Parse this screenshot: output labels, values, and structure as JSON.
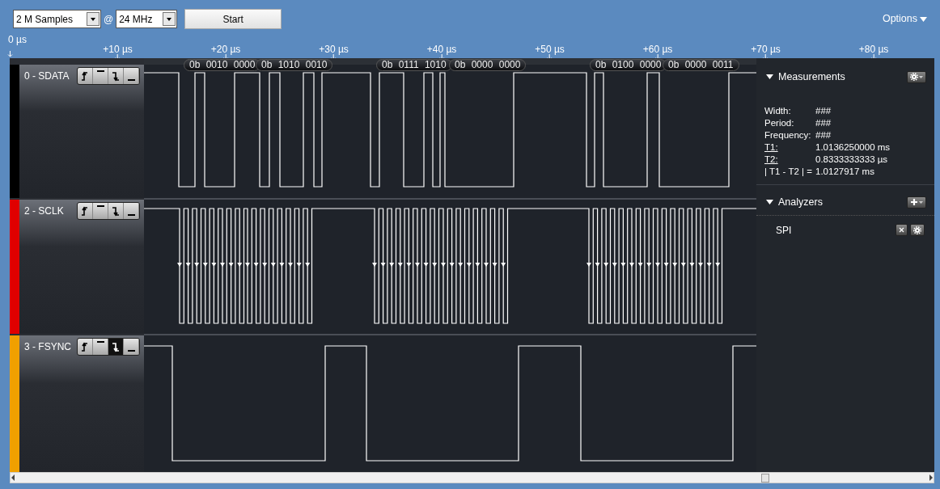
{
  "toolbar": {
    "sample_count": "2 M Samples",
    "at_sign": "@",
    "sample_rate": "24 MHz",
    "start_button": "Start",
    "options": "Options"
  },
  "ruler": {
    "origin": "0 µs",
    "ticks": [
      "+10 µs",
      "+20 µs",
      "+30 µs",
      "+40 µs",
      "+50 µs",
      "+60 µs",
      "+70 µs",
      "+80 µs"
    ]
  },
  "channels": [
    {
      "name": "0 - SDATA",
      "color": "#000000",
      "triggers": [
        {
          "kind": "rising",
          "selected": false
        },
        {
          "kind": "high",
          "selected": false
        },
        {
          "kind": "falling",
          "selected": false
        },
        {
          "kind": "low",
          "selected": false
        }
      ]
    },
    {
      "name": "2 - SCLK",
      "color": "#e00000",
      "triggers": [
        {
          "kind": "rising",
          "selected": false
        },
        {
          "kind": "high",
          "selected": false
        },
        {
          "kind": "falling",
          "selected": false
        },
        {
          "kind": "low",
          "selected": false
        }
      ]
    },
    {
      "name": "3 - FSYNC",
      "color": "#f0a000",
      "triggers": [
        {
          "kind": "rising",
          "selected": false
        },
        {
          "kind": "high",
          "selected": false
        },
        {
          "kind": "falling",
          "selected": true
        },
        {
          "kind": "low",
          "selected": false
        }
      ]
    }
  ],
  "decoded": [
    "0b 0010 0000",
    "0b 1010 0010",
    "0b 0111 1010",
    "0b 0000 0000",
    "0b 0100 0000",
    "0b 0000 0011"
  ],
  "measurements": {
    "title": "Measurements",
    "rows": [
      {
        "label": "Width:",
        "value": "###",
        "underlined": false
      },
      {
        "label": "Period:",
        "value": "###",
        "underlined": false
      },
      {
        "label": "Frequency:",
        "value": "###",
        "underlined": false
      },
      {
        "label": "T1:",
        "value": "1.0136250000 ms",
        "underlined": true
      },
      {
        "label": "T2:",
        "value": "0.8333333333 µs",
        "underlined": true
      },
      {
        "label": "| T1 - T2 | =",
        "value": "1.0127917 ms",
        "underlined": false
      }
    ]
  },
  "analyzers": {
    "title": "Analyzers",
    "items": [
      {
        "name": "SPI"
      }
    ]
  }
}
